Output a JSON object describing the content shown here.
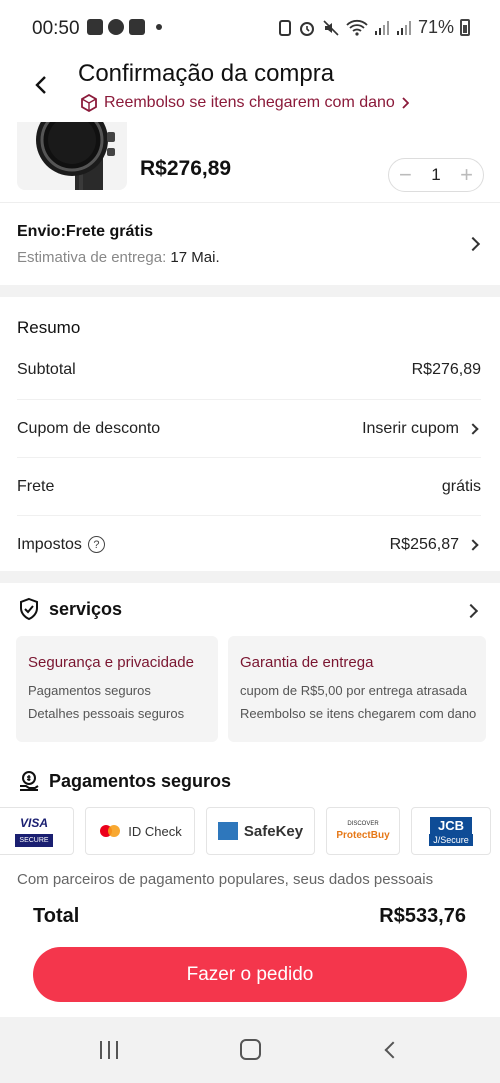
{
  "status": {
    "time": "00:50",
    "battery": "71%"
  },
  "header": {
    "title": "Confirmação da compra",
    "refund_text": "Reembolso se itens chegarem com dano"
  },
  "product": {
    "price": "R$276,89",
    "quantity": "1",
    "minus": "−",
    "plus": "+"
  },
  "shipping": {
    "title": "Envio:Frete grátis",
    "estimate_label": "Estimativa de entrega: ",
    "estimate_date": "17 Mai."
  },
  "summary": {
    "title": "Resumo",
    "rows": [
      {
        "label": "Subtotal",
        "value": "R$276,89"
      },
      {
        "label": "Cupom de desconto",
        "value": "Inserir cupom"
      },
      {
        "label": "Frete",
        "value": "grátis"
      },
      {
        "label": "Impostos",
        "value": "R$256,87"
      }
    ]
  },
  "services": {
    "title": "serviços",
    "cards": [
      {
        "title": "Segurança e privacidade",
        "lines": [
          "Pagamentos seguros",
          "Detalhes pessoais seguros"
        ]
      },
      {
        "title": "Garantia de entrega",
        "lines": [
          "cupom de R$5,00 por entrega atrasada",
          "Reembolso se itens chegarem com dano"
        ]
      }
    ]
  },
  "payments": {
    "title": "Pagamentos seguros",
    "logos": [
      "VISA",
      "SECURE",
      "ID Check",
      "SafeKey",
      "DISCOVER",
      "ProtectBuy",
      "JCB",
      "J/Secure"
    ],
    "note": "Com parceiros de pagamento populares, seus dados pessoais"
  },
  "footer": {
    "total_label": "Total",
    "total_value": "R$533,76",
    "order_button": "Fazer o pedido"
  },
  "colors": {
    "accent": "#f4364c",
    "brand_dark_red": "#8b1a3a"
  }
}
